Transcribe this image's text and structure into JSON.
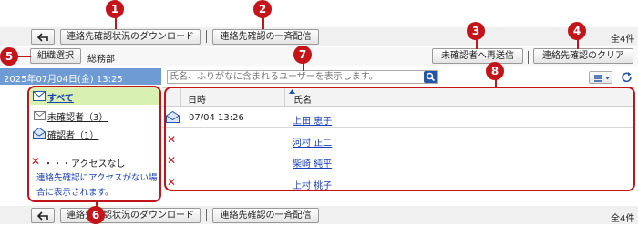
{
  "toolbar": {
    "download_label": "連絡先確認状況のダウンロード",
    "broadcast_label": "連絡先確認の一斉配信",
    "total": "全4件"
  },
  "row2": {
    "select_org_label": "組織選択",
    "org_name": "総務部",
    "resend_label": "未確認者へ再送信",
    "clear_label": "連絡先確認のクリア"
  },
  "date_header": "2025年07月04日(金) 13:25",
  "search": {
    "placeholder": "氏名、ふりがなに含まれるユーザーを表示します。"
  },
  "left_panel": {
    "all": "すべて",
    "unconfirmed": "未確認者（3）",
    "confirmed": "確認者（1）",
    "no_access": "・・・アクセスなし",
    "note": "連絡先確認にアクセスがない場合に表示されます。"
  },
  "table": {
    "headers": [
      "日時",
      "氏名"
    ],
    "rows": [
      {
        "status": "confirmed",
        "datetime": "07/04 13:26",
        "name": "上田 恵子"
      },
      {
        "status": "no_access",
        "datetime": "",
        "name": "河村 正二"
      },
      {
        "status": "no_access",
        "datetime": "",
        "name": "柴崎 純平"
      },
      {
        "status": "no_access",
        "datetime": "",
        "name": "上村 桃子"
      }
    ]
  },
  "markers": [
    "1",
    "2",
    "3",
    "4",
    "5",
    "6",
    "7",
    "8"
  ],
  "colors": {
    "accent_red": "#c5131a",
    "date_bar": "#6e9bd4",
    "link": "#1a3fb8",
    "selected": "#d8f0b0"
  }
}
